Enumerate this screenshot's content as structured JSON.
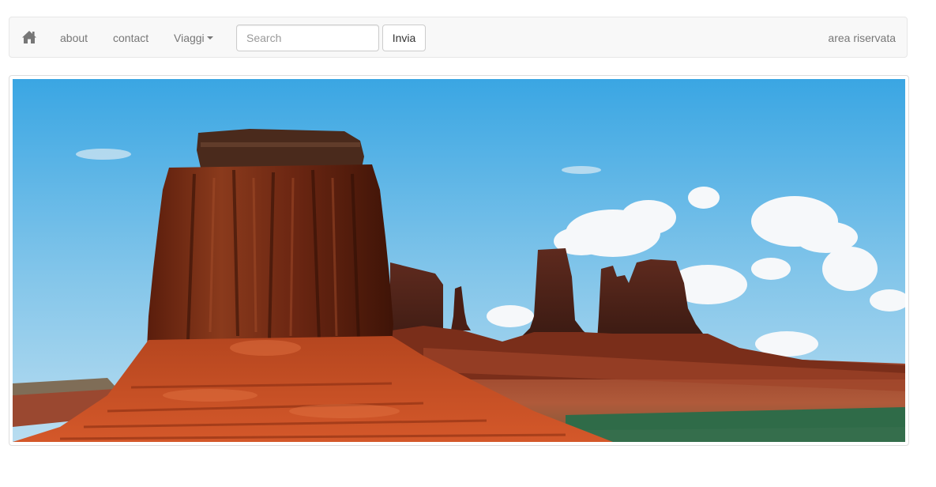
{
  "navbar": {
    "home_icon": "home-icon",
    "links": [
      "about",
      "contact"
    ],
    "dropdown_label": "Viaggi",
    "search_placeholder": "Search",
    "submit_label": "Invia",
    "right_link": "area riservata"
  },
  "banner": {
    "description_icon": "landscape-photo"
  },
  "colors": {
    "navbar_bg": "#f8f8f8",
    "link": "#777777",
    "border": "#dddddd"
  }
}
